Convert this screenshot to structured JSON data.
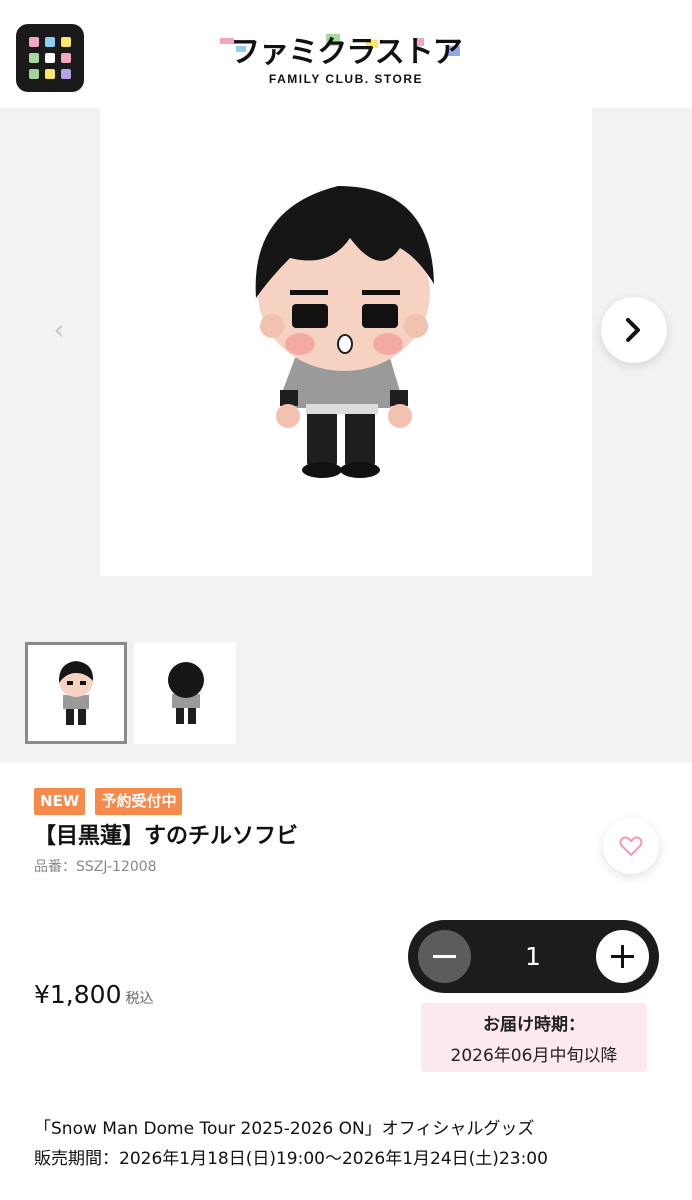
{
  "header": {
    "logo_text": "ファミクラストア",
    "logo_subtext": "FAMILY CLUB. STORE"
  },
  "gallery": {
    "main_image_alt": "",
    "thumbnails": [
      "front",
      "back"
    ]
  },
  "product": {
    "badges": [
      "NEW",
      "予約受付中"
    ],
    "title": "【目黒蓮】すのチルソフビ",
    "sku": "品番：SSZJ-12008",
    "price": "¥1,800",
    "tax_label": "税込",
    "quantity": "1",
    "delivery_label": "お届け時期：",
    "delivery_date": "2026年06月中旬以降",
    "description_line1": "「Snow Man Dome Tour 2025-2026 ON」オフィシャルグッズ",
    "description_line2": "販売期間：2026年1月18日(日)19:00〜2026年1月24日(土)23:00"
  },
  "colors": {
    "badge_orange": "#f58a4b",
    "qty_bg": "#1c1c1c",
    "delivery_bg": "#fbe9ee",
    "heart_pink": "#f29ab4"
  },
  "icons": [
    "app-grid-icon",
    "chevron-left-icon",
    "chevron-right-icon",
    "heart-icon",
    "minus-icon",
    "plus-icon"
  ]
}
